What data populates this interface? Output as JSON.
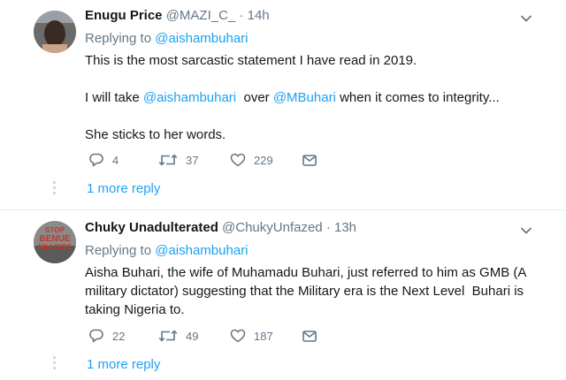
{
  "tweets": [
    {
      "name": "Enugu Price",
      "handle": "@MAZI_C_",
      "dot": "·",
      "time": "14h",
      "replying_prefix": "Replying to ",
      "replying_to": "@aishambuhari",
      "line1": "This is the most sarcastic statement I have read in 2019.",
      "line2_a": "I will take ",
      "line2_m1": "@aishambuhari",
      "line2_b": "  over ",
      "line2_m2": "@MBuhari",
      "line2_c": " when it comes to integrity...",
      "line3": "She sticks to her words.",
      "replies": "4",
      "retweets": "37",
      "likes": "229",
      "more_replies": "1 more reply"
    },
    {
      "name": "Chuky Unadulterated",
      "handle": "@ChukyUnfazed",
      "dot": "·",
      "time": "13h",
      "replying_prefix": "Replying to ",
      "replying_to": "@aishambuhari",
      "body": "Aisha Buhari, the wife of Muhamadu Buhari, just referred to him as GMB (A military dictator) suggesting that the Military era is the Next Level  Buhari is taking Nigeria to.",
      "avatar_text_1": "STOP",
      "avatar_text_2": "BENUE",
      "avatar_text_3": "KILLINGS",
      "replies": "22",
      "retweets": "49",
      "likes": "187",
      "more_replies": "1 more reply"
    }
  ],
  "colors": {
    "accent": "#1da1f2",
    "muted": "#657786",
    "text": "#14171a",
    "divider": "#e6ecf0"
  },
  "icons": [
    "reply-icon",
    "retweet-icon",
    "like-icon",
    "direct-message-icon",
    "chevron-down-icon"
  ]
}
